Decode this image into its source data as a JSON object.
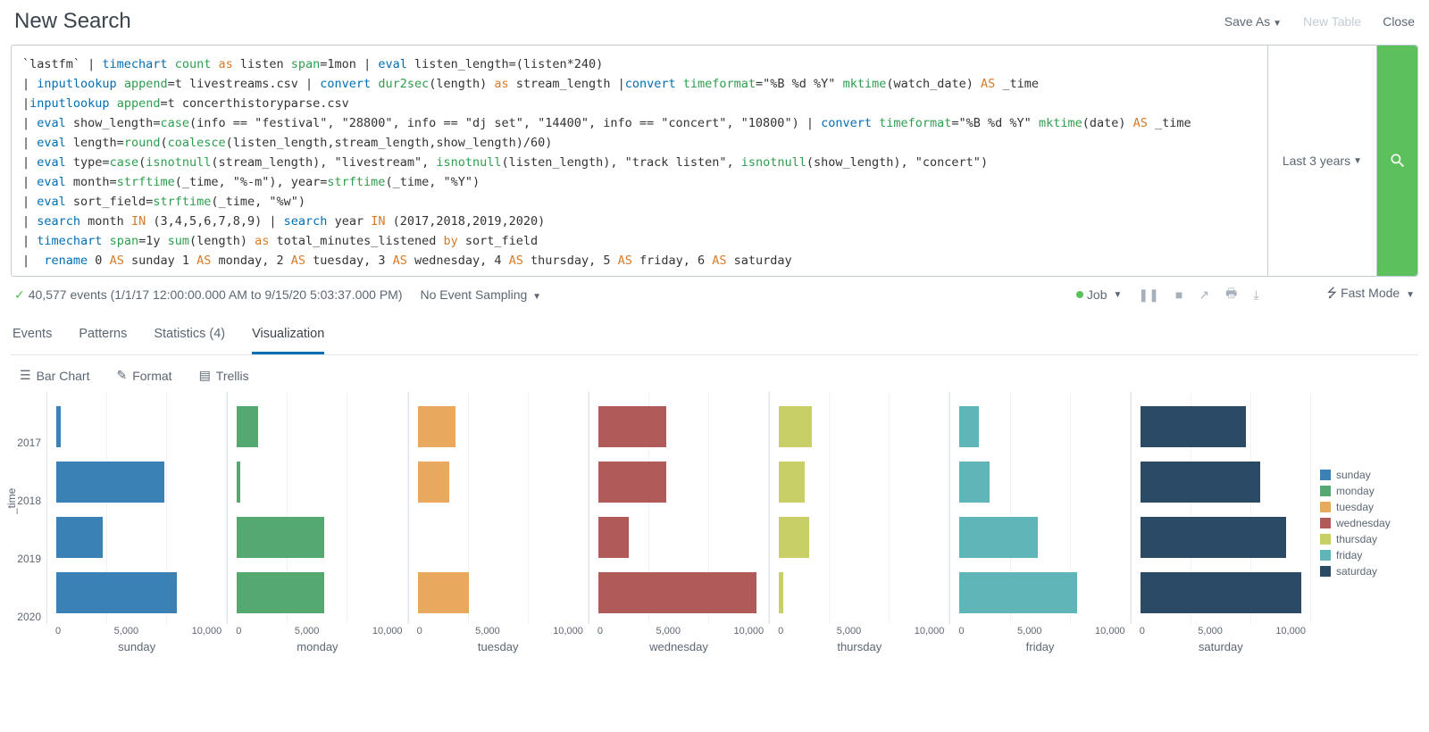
{
  "header": {
    "title": "New Search",
    "save_as": "Save As",
    "new_table": "New Table",
    "close": "Close"
  },
  "search": {
    "time_range": "Last 3 years",
    "tokens": [
      [
        [
          "gray",
          "`lastfm` | "
        ],
        [
          "blue",
          "timechart"
        ],
        [
          "gray",
          " "
        ],
        [
          "green",
          "count"
        ],
        [
          "gray",
          " "
        ],
        [
          "orange",
          "as"
        ],
        [
          "gray",
          " listen "
        ],
        [
          "green",
          "span"
        ],
        [
          "gray",
          "=1mon | "
        ],
        [
          "blue",
          "eval"
        ],
        [
          "gray",
          " listen_length=(listen*240)"
        ]
      ],
      [
        [
          "gray",
          "| "
        ],
        [
          "blue",
          "inputlookup"
        ],
        [
          "gray",
          " "
        ],
        [
          "green",
          "append"
        ],
        [
          "gray",
          "=t livestreams.csv | "
        ],
        [
          "blue",
          "convert"
        ],
        [
          "gray",
          " "
        ],
        [
          "green",
          "dur2sec"
        ],
        [
          "gray",
          "(length) "
        ],
        [
          "orange",
          "as"
        ],
        [
          "gray",
          " stream_length |"
        ],
        [
          "blue",
          "convert"
        ],
        [
          "gray",
          " "
        ],
        [
          "green",
          "timeformat"
        ],
        [
          "gray",
          "=\"%B %d %Y\" "
        ],
        [
          "green",
          "mktime"
        ],
        [
          "gray",
          "(watch_date) "
        ],
        [
          "orange",
          "AS"
        ],
        [
          "gray",
          " _time"
        ]
      ],
      [
        [
          "gray",
          "|"
        ],
        [
          "blue",
          "inputlookup"
        ],
        [
          "gray",
          " "
        ],
        [
          "green",
          "append"
        ],
        [
          "gray",
          "=t concerthistoryparse.csv"
        ]
      ],
      [
        [
          "gray",
          "| "
        ],
        [
          "blue",
          "eval"
        ],
        [
          "gray",
          " show_length="
        ],
        [
          "green",
          "case"
        ],
        [
          "gray",
          "(info == \"festival\", \"28800\", info == \"dj set\", \"14400\", info == \"concert\", \"10800\") | "
        ],
        [
          "blue",
          "convert"
        ],
        [
          "gray",
          " "
        ],
        [
          "green",
          "timeformat"
        ],
        [
          "gray",
          "=\"%B %d %Y\" "
        ],
        [
          "green",
          "mktime"
        ],
        [
          "gray",
          "(date) "
        ],
        [
          "orange",
          "AS"
        ],
        [
          "gray",
          " _time"
        ]
      ],
      [
        [
          "gray",
          "| "
        ],
        [
          "blue",
          "eval"
        ],
        [
          "gray",
          " length="
        ],
        [
          "green",
          "round"
        ],
        [
          "gray",
          "("
        ],
        [
          "green",
          "coalesce"
        ],
        [
          "gray",
          "(listen_length,stream_length,show_length)/60)"
        ]
      ],
      [
        [
          "gray",
          "| "
        ],
        [
          "blue",
          "eval"
        ],
        [
          "gray",
          " type="
        ],
        [
          "green",
          "case"
        ],
        [
          "gray",
          "("
        ],
        [
          "green",
          "isnotnull"
        ],
        [
          "gray",
          "(stream_length), \"livestream\", "
        ],
        [
          "green",
          "isnotnull"
        ],
        [
          "gray",
          "(listen_length), \"track listen\", "
        ],
        [
          "green",
          "isnotnull"
        ],
        [
          "gray",
          "(show_length), \"concert\")"
        ]
      ],
      [
        [
          "gray",
          "| "
        ],
        [
          "blue",
          "eval"
        ],
        [
          "gray",
          " month="
        ],
        [
          "green",
          "strftime"
        ],
        [
          "gray",
          "(_time, \"%-m\"), year="
        ],
        [
          "green",
          "strftime"
        ],
        [
          "gray",
          "(_time, \"%Y\")"
        ]
      ],
      [
        [
          "gray",
          "| "
        ],
        [
          "blue",
          "eval"
        ],
        [
          "gray",
          " sort_field="
        ],
        [
          "green",
          "strftime"
        ],
        [
          "gray",
          "(_time, \"%w\")"
        ]
      ],
      [
        [
          "gray",
          "| "
        ],
        [
          "blue",
          "search"
        ],
        [
          "gray",
          " month "
        ],
        [
          "orange",
          "IN"
        ],
        [
          "gray",
          " (3,4,5,6,7,8,9) | "
        ],
        [
          "blue",
          "search"
        ],
        [
          "gray",
          " year "
        ],
        [
          "orange",
          "IN"
        ],
        [
          "gray",
          " (2017,2018,2019,2020)"
        ]
      ],
      [
        [
          "gray",
          "| "
        ],
        [
          "blue",
          "timechart"
        ],
        [
          "gray",
          " "
        ],
        [
          "green",
          "span"
        ],
        [
          "gray",
          "=1y "
        ],
        [
          "green",
          "sum"
        ],
        [
          "gray",
          "(length) "
        ],
        [
          "orange",
          "as"
        ],
        [
          "gray",
          " total_minutes_listened "
        ],
        [
          "orange",
          "by"
        ],
        [
          "gray",
          " sort_field"
        ]
      ],
      [
        [
          "gray",
          "|  "
        ],
        [
          "blue",
          "rename"
        ],
        [
          "gray",
          " 0 "
        ],
        [
          "orange",
          "AS"
        ],
        [
          "gray",
          " sunday 1 "
        ],
        [
          "orange",
          "AS"
        ],
        [
          "gray",
          " monday, 2 "
        ],
        [
          "orange",
          "AS"
        ],
        [
          "gray",
          " tuesday, 3 "
        ],
        [
          "orange",
          "AS"
        ],
        [
          "gray",
          " wednesday, 4 "
        ],
        [
          "orange",
          "AS"
        ],
        [
          "gray",
          " thursday, 5 "
        ],
        [
          "orange",
          "AS"
        ],
        [
          "gray",
          " friday, 6 "
        ],
        [
          "orange",
          "AS"
        ],
        [
          "gray",
          " saturday"
        ]
      ]
    ]
  },
  "status": {
    "events_text": "40,577 events (1/1/17 12:00:00.000 AM to 9/15/20 5:03:37.000 PM)",
    "sampling": "No Event Sampling",
    "job": "Job",
    "mode": "Fast Mode"
  },
  "tabs": {
    "events": "Events",
    "patterns": "Patterns",
    "statistics": "Statistics (4)",
    "visualization": "Visualization"
  },
  "viz_toolbar": {
    "chart_type": "Bar Chart",
    "format": "Format",
    "trellis": "Trellis"
  },
  "chart_data": {
    "type": "bar",
    "layout": "trellis-horizontal-bars",
    "ylabel": "_time",
    "categories": [
      "2017",
      "2018",
      "2019",
      "2020"
    ],
    "x_ticks": [
      0,
      5000,
      10000
    ],
    "x_tick_labels": [
      "0",
      "5,000",
      "10,000"
    ],
    "xlim": [
      0,
      11000
    ],
    "series": [
      {
        "name": "sunday",
        "color": "#3a81b5",
        "values": [
          300,
          7200,
          3100,
          8000
        ]
      },
      {
        "name": "monday",
        "color": "#56a871",
        "values": [
          1400,
          200,
          5800,
          5800
        ]
      },
      {
        "name": "tuesday",
        "color": "#e8a95e",
        "values": [
          2500,
          2100,
          0,
          3400
        ]
      },
      {
        "name": "wednesday",
        "color": "#b05a5a",
        "values": [
          4500,
          4500,
          2000,
          10500
        ]
      },
      {
        "name": "thursday",
        "color": "#c7cf66",
        "values": [
          2200,
          1700,
          2000,
          300
        ]
      },
      {
        "name": "friday",
        "color": "#5fb5b8",
        "values": [
          1300,
          2000,
          5200,
          7800
        ]
      },
      {
        "name": "saturday",
        "color": "#2b4a66",
        "values": [
          7000,
          8000,
          9700,
          10700
        ]
      }
    ],
    "legend_labels": [
      "sunday",
      "monday",
      "tuesday",
      "wednesday",
      "thursday",
      "friday",
      "saturday"
    ]
  }
}
